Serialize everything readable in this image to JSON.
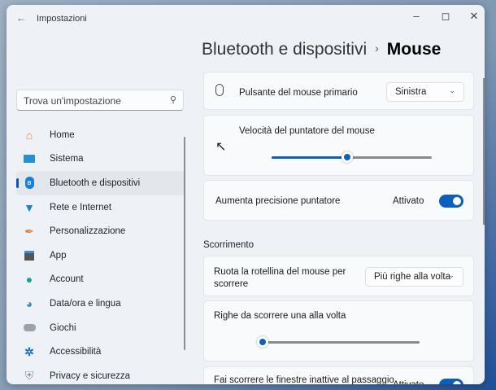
{
  "window": {
    "title": "Impostazioni",
    "back_icon": "arrow-left-icon",
    "controls": [
      "minimize",
      "maximize",
      "close"
    ]
  },
  "breadcrumb": {
    "parent": "Bluetooth e dispositivi",
    "separator": "›",
    "current": "Mouse"
  },
  "search": {
    "placeholder": "Trova un'impostazione"
  },
  "sidebar": {
    "items": [
      {
        "label": "Home",
        "icon": "home-icon"
      },
      {
        "label": "Sistema",
        "icon": "monitor-icon"
      },
      {
        "label": "Bluetooth e dispositivi",
        "icon": "bluetooth-icon",
        "active": true
      },
      {
        "label": "Rete e Internet",
        "icon": "wifi-icon"
      },
      {
        "label": "Personalizzazione",
        "icon": "brush-icon"
      },
      {
        "label": "App",
        "icon": "apps-icon"
      },
      {
        "label": "Account",
        "icon": "person-icon"
      },
      {
        "label": "Data/ora e lingua",
        "icon": "globe-clock-icon"
      },
      {
        "label": "Giochi",
        "icon": "gamepad-icon"
      },
      {
        "label": "Accessibilità",
        "icon": "accessibility-icon"
      },
      {
        "label": "Privacy e sicurezza",
        "icon": "shield-icon"
      }
    ]
  },
  "main": {
    "primary_button": {
      "label": "Pulsante del mouse primario",
      "value": "Sinistra"
    },
    "pointer_speed": {
      "label": "Velocità del puntatore del mouse",
      "value": 10,
      "min": 1,
      "max": 20
    },
    "precision": {
      "label": "Aumenta precisione puntatore",
      "state": "Attivato",
      "on": true
    },
    "scroll_section": "Scorrimento",
    "wheel": {
      "label": "Ruota la rotellina del mouse per scorrere",
      "value": "Più righe alla volta"
    },
    "lines": {
      "label": "Righe da scorrere una alla volta",
      "value": 3,
      "min": 1,
      "max": 100
    },
    "inactive": {
      "label": "Fai scorrere le finestre inattive al passaggio",
      "state": "Attivato",
      "on": true
    }
  },
  "colors": {
    "accent": "#0a5fbf"
  }
}
